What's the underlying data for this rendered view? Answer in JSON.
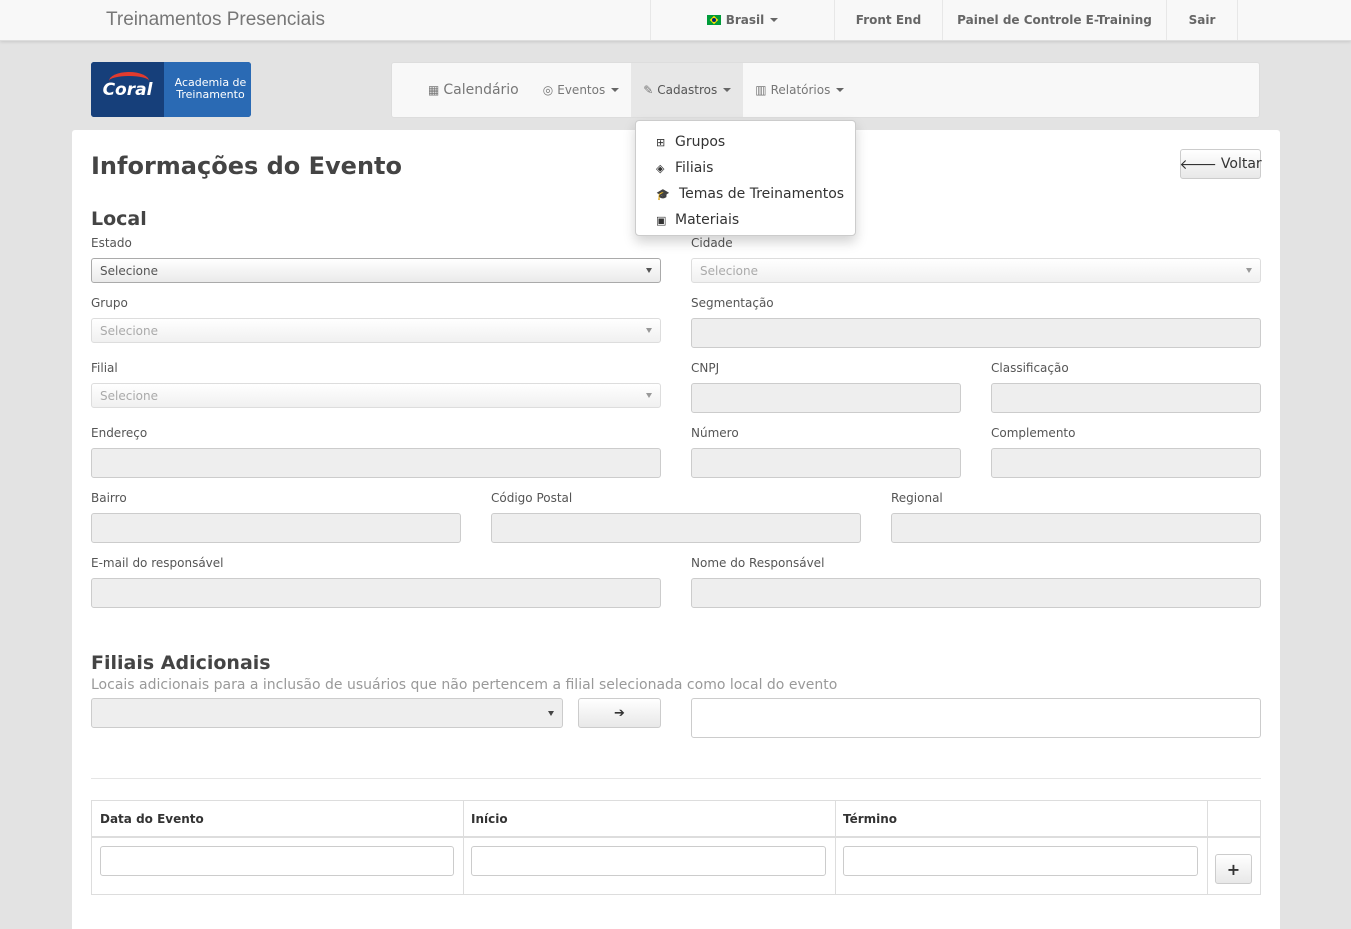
{
  "topbar": {
    "brand": "Treinamentos Presenciais",
    "nav": [
      {
        "label": "Brasil",
        "has_flag": true,
        "has_caret": true
      },
      {
        "label": "Front End"
      },
      {
        "label": "Painel de Controle E-Training"
      },
      {
        "label": "Sair"
      }
    ]
  },
  "logo": {
    "brand": "Coral",
    "line1": "Academia de",
    "line2": "Treinamento"
  },
  "mainnav": {
    "items": [
      {
        "label": "Calendário",
        "icon": "calendar-icon"
      },
      {
        "label": "Eventos",
        "icon": "handshake-icon"
      },
      {
        "label": "Cadastros",
        "icon": "pencil-icon"
      },
      {
        "label": "Relatórios",
        "icon": "bar-chart-icon"
      }
    ]
  },
  "dropdown": {
    "items": [
      {
        "label": "Grupos",
        "icon": "sitemap-icon"
      },
      {
        "label": "Filiais",
        "icon": "cube-icon"
      },
      {
        "label": "Temas de Treinamentos",
        "icon": "graduation-cap-icon"
      },
      {
        "label": "Materiais",
        "icon": "briefcase-icon"
      }
    ]
  },
  "page": {
    "title": "Informações do Evento",
    "back_button": "Voltar"
  },
  "local": {
    "section_title": "Local",
    "estado_label": "Estado",
    "estado_placeholder": "Selecione",
    "cidade_label": "Cidade",
    "cidade_placeholder": "Selecione",
    "grupo_label": "Grupo",
    "grupo_placeholder": "Selecione",
    "segmentacao_label": "Segmentação",
    "filial_label": "Filial",
    "filial_placeholder": "Selecione",
    "cnpj_label": "CNPJ",
    "classificacao_label": "Classificação",
    "endereco_label": "Endereço",
    "numero_label": "Número",
    "complemento_label": "Complemento",
    "bairro_label": "Bairro",
    "codigo_postal_label": "Código Postal",
    "regional_label": "Regional",
    "email_label": "E-mail do responsável",
    "nome_label": "Nome do Responsável"
  },
  "filiais": {
    "section_title": "Filiais Adicionais",
    "help": "Locais adicionais para a inclusão de usuários que não pertencem a filial selecionada como local do evento",
    "add_icon": "arrow-right-icon"
  },
  "table": {
    "headers": [
      "Data do Evento",
      "Início",
      "Término"
    ],
    "add_label": "+"
  }
}
